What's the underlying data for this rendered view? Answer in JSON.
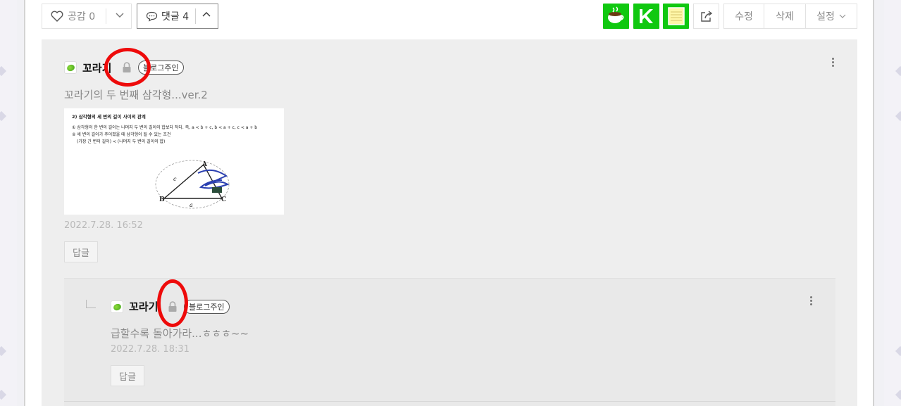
{
  "toolbar": {
    "like_label": "공감 0",
    "comment_label": "댓글 4",
    "edit_label": "수정",
    "delete_label": "삭제",
    "settings_label": "설정"
  },
  "comments": [
    {
      "author": "꼬라기",
      "badge": "블로그주인",
      "text": "꼬라기의 두 번째 삼각형...ver.2",
      "date": "2022.7.28. 16:52",
      "reply_label": "답글",
      "image": {
        "heading": "2) 삼각형의 세 변의 길이 사이의 관계",
        "line1": "① 삼각형의 한 변의 길이는 나머지 두 변의 길이의 합보다 작다. 즉, a < b + c, b < a + c, c < a + b",
        "line2": "② 세 변의 길이가 주어졌을 때 삼각형이 될 수 있는 조건",
        "line3": "(가장 긴 변의 길이) < (나머지 두 변의 길이의 합)",
        "label_a": "A",
        "label_b": "B",
        "label_c": "C",
        "side_a": "a",
        "side_c": "c"
      }
    },
    {
      "author": "꼬라기",
      "badge": "블로그주인",
      "text": "급할수록 돌아가라...ㅎㅎㅎ~~",
      "date": "2022.7.28. 18:31",
      "reply_label": "답글"
    }
  ],
  "colors": {
    "annotation_circle": "#ee0a0a",
    "app_button_green": "#10c810"
  }
}
